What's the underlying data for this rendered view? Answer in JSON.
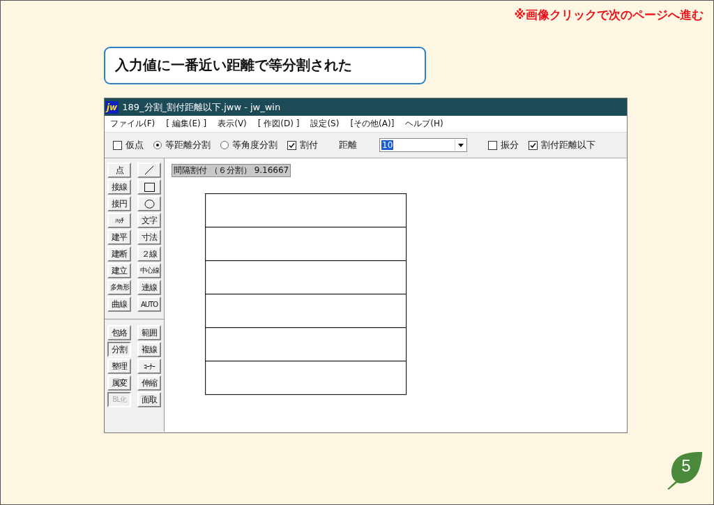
{
  "note": "※画像クリックで次のページへ進む",
  "heading": "入力値に一番近い距離で等分割された",
  "window": {
    "app_logo": "jw",
    "title": "189_分割_割付距離以下.jww - jw_win",
    "menu": [
      "ファイル(F)",
      "[ 編集(E) ]",
      "表示(V)",
      "[ 作図(D) ]",
      "設定(S)",
      "[その他(A)]",
      "ヘルプ(H)"
    ],
    "toolbar": [
      {
        "kind": "checkbox",
        "label": "仮点",
        "checked": false
      },
      {
        "kind": "radio",
        "label": "等距離分割",
        "selected": true
      },
      {
        "kind": "radio",
        "label": "等角度分割",
        "selected": false
      },
      {
        "kind": "checkbox",
        "label": "割付",
        "checked": true
      },
      {
        "kind": "label",
        "label": "距離"
      },
      {
        "kind": "combo",
        "value": "10"
      },
      {
        "kind": "checkbox",
        "label": "振分",
        "checked": false
      },
      {
        "kind": "checkbox",
        "label": "割付距離以下",
        "checked": true
      }
    ],
    "tool_groups": [
      [
        {
          "kind": "text",
          "label": "点",
          "selected": false,
          "disabled": false
        },
        {
          "kind": "line",
          "selected": false,
          "disabled": false
        },
        {
          "kind": "text",
          "label": "接線",
          "selected": false,
          "disabled": false
        },
        {
          "kind": "rect",
          "selected": false,
          "disabled": false
        },
        {
          "kind": "text",
          "label": "接円",
          "selected": false,
          "disabled": false
        },
        {
          "kind": "circle",
          "selected": false,
          "disabled": false
        },
        {
          "kind": "text",
          "label": "ﾊｯﾁ",
          "selected": false,
          "disabled": false
        },
        {
          "kind": "text",
          "label": "文字",
          "selected": false,
          "disabled": false
        },
        {
          "kind": "text",
          "label": "建平",
          "selected": false,
          "disabled": false
        },
        {
          "kind": "text",
          "label": "寸法",
          "selected": false,
          "disabled": false
        },
        {
          "kind": "text",
          "label": "建断",
          "selected": false,
          "disabled": false
        },
        {
          "kind": "text",
          "label": "２線",
          "selected": false,
          "disabled": false
        },
        {
          "kind": "text",
          "label": "建立",
          "selected": false,
          "disabled": false
        },
        {
          "kind": "text",
          "label": "中心線",
          "selected": false,
          "disabled": false
        },
        {
          "kind": "text",
          "label": "多角形",
          "selected": false,
          "disabled": false
        },
        {
          "kind": "text",
          "label": "連線",
          "selected": false,
          "disabled": false
        },
        {
          "kind": "text",
          "label": "曲線",
          "selected": false,
          "disabled": false
        },
        {
          "kind": "text",
          "label": "AUTO",
          "selected": false,
          "disabled": false
        }
      ],
      [
        {
          "kind": "text",
          "label": "包絡",
          "selected": false,
          "disabled": false
        },
        {
          "kind": "text",
          "label": "範囲",
          "selected": false,
          "disabled": false
        },
        {
          "kind": "text",
          "label": "分割",
          "selected": true,
          "disabled": false
        },
        {
          "kind": "text",
          "label": "複線",
          "selected": false,
          "disabled": false
        },
        {
          "kind": "text",
          "label": "整理",
          "selected": false,
          "disabled": false
        },
        {
          "kind": "text",
          "label": "ｺｰﾅｰ",
          "selected": false,
          "disabled": false
        },
        {
          "kind": "text",
          "label": "属変",
          "selected": false,
          "disabled": false
        },
        {
          "kind": "text",
          "label": "伸縮",
          "selected": false,
          "disabled": false
        },
        {
          "kind": "text",
          "label": "BL化",
          "selected": true,
          "disabled": true
        },
        {
          "kind": "text",
          "label": "面取",
          "selected": false,
          "disabled": false
        }
      ]
    ],
    "status_message": "間隔割付 （６分割） 9.16667"
  },
  "page_number": "5"
}
